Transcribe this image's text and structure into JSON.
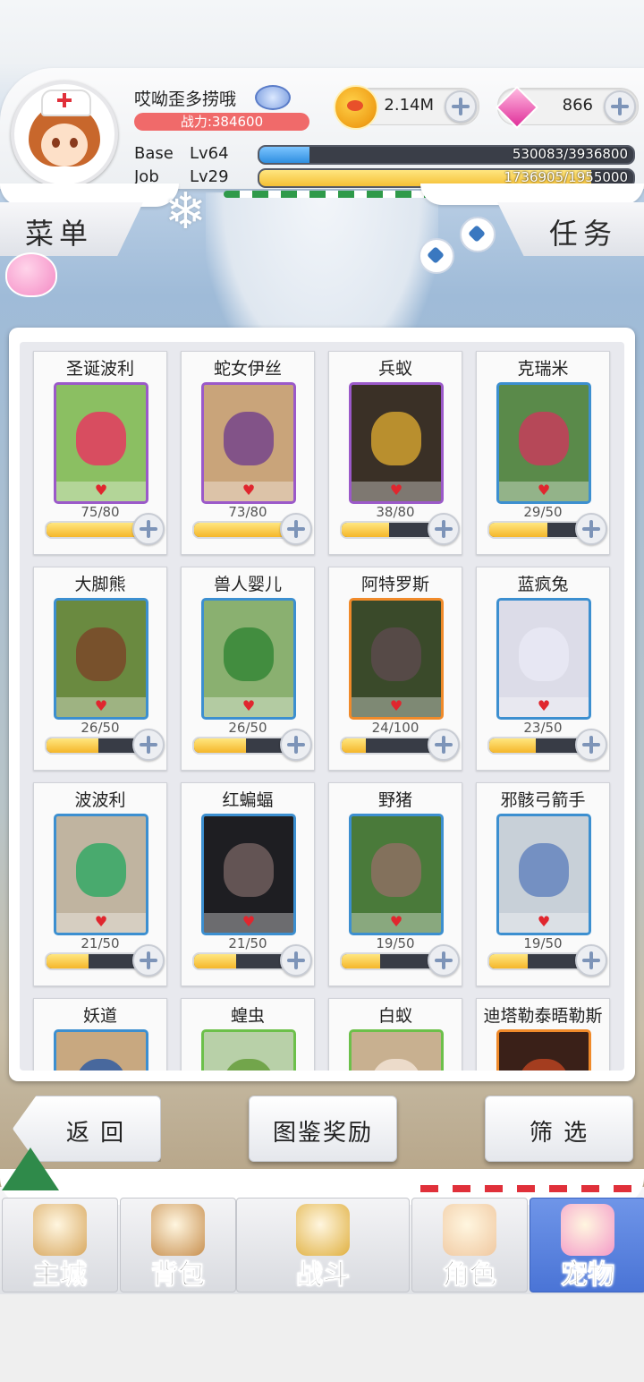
{
  "player": {
    "name": "哎呦歪多捞哦",
    "power": "战力:384600",
    "base_label": "Base",
    "base_level": "Lv64",
    "base_exp": "530083/3936800",
    "base_progress": 0.135,
    "job_label": "Job",
    "job_level": "Lv29",
    "job_exp": "1736905/1955000",
    "job_progress": 0.888
  },
  "currency": {
    "gold": "2.14M",
    "gems": "866"
  },
  "header_buttons": {
    "menu": "菜单",
    "quest": "任务"
  },
  "pets": [
    {
      "name": "圣诞波利",
      "count": "75/80",
      "progress": 0.9375,
      "frame": "#9b59c9"
    },
    {
      "name": "蛇女伊丝",
      "count": "73/80",
      "progress": 0.9125,
      "frame": "#9b59c9"
    },
    {
      "name": "兵蚁",
      "count": "38/80",
      "progress": 0.475,
      "frame": "#9b59c9"
    },
    {
      "name": "克瑞米",
      "count": "29/50",
      "progress": 0.58,
      "frame": "#3c8fd0"
    },
    {
      "name": "大脚熊",
      "count": "26/50",
      "progress": 0.52,
      "frame": "#3c8fd0"
    },
    {
      "name": "兽人婴儿",
      "count": "26/50",
      "progress": 0.52,
      "frame": "#3c8fd0"
    },
    {
      "name": "阿特罗斯",
      "count": "24/100",
      "progress": 0.24,
      "frame": "#f08a2a"
    },
    {
      "name": "蓝疯兔",
      "count": "23/50",
      "progress": 0.46,
      "frame": "#3c8fd0"
    },
    {
      "name": "波波利",
      "count": "21/50",
      "progress": 0.42,
      "frame": "#3c8fd0"
    },
    {
      "name": "红蝙蝠",
      "count": "21/50",
      "progress": 0.42,
      "frame": "#3c8fd0"
    },
    {
      "name": "野猪",
      "count": "19/50",
      "progress": 0.38,
      "frame": "#3c8fd0"
    },
    {
      "name": "邪骸弓箭手",
      "count": "19/50",
      "progress": 0.38,
      "frame": "#3c8fd0"
    },
    {
      "name": "妖道",
      "count": "",
      "progress": 0,
      "frame": "#3c8fd0"
    },
    {
      "name": "蝗虫",
      "count": "",
      "progress": 0,
      "frame": "#6cc04a"
    },
    {
      "name": "白蚁",
      "count": "",
      "progress": 0,
      "frame": "#6cc04a"
    },
    {
      "name": "迪塔勒泰晤勒斯",
      "count": "",
      "progress": 0,
      "frame": "#f08a2a"
    }
  ],
  "actions": {
    "back": "返 回",
    "rewards": "图鉴奖励",
    "filter": "筛 选"
  },
  "nav": [
    {
      "label": "主城",
      "icon": "castle-icon",
      "active": false
    },
    {
      "label": "背包",
      "icon": "backpack-icon",
      "active": false
    },
    {
      "label": "战斗",
      "icon": "battle-icon",
      "active": false
    },
    {
      "label": "角色",
      "icon": "character-icon",
      "active": false
    },
    {
      "label": "宠物",
      "icon": "pet-icon",
      "active": true
    }
  ],
  "colors": {
    "accent_blue": "#4a74d6",
    "power_red": "#f06a6a",
    "exp_blue": "#2f8fe0",
    "exp_yellow": "#f5c036"
  }
}
